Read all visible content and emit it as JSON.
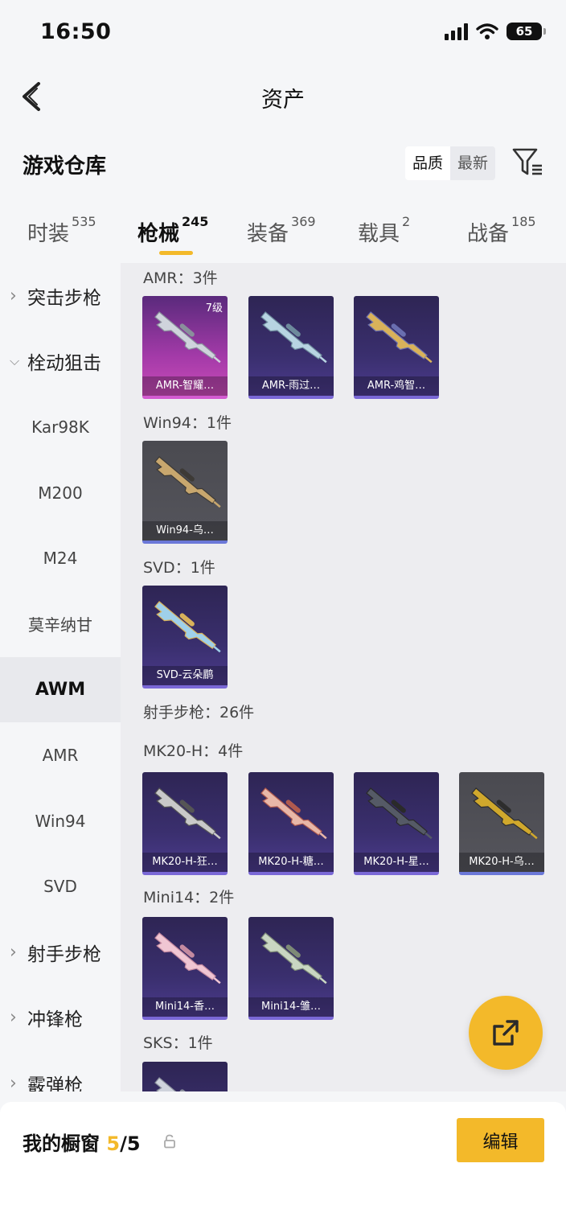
{
  "status_bar": {
    "time": "16:50",
    "battery": "65"
  },
  "header": {
    "title": "资产"
  },
  "warehouse": {
    "title": "游戏仓库",
    "sort_options": [
      "品质",
      "最新"
    ],
    "active_sort": "品质"
  },
  "tabs": [
    {
      "label": "时装",
      "count": "535"
    },
    {
      "label": "枪械",
      "count": "245",
      "active": true
    },
    {
      "label": "装备",
      "count": "369"
    },
    {
      "label": "载具",
      "count": "2"
    },
    {
      "label": "战备",
      "count": "185"
    }
  ],
  "sidebar": {
    "items": [
      {
        "label": "突击步枪",
        "type": "category",
        "expanded": false
      },
      {
        "label": "栓动狙击",
        "type": "category",
        "expanded": true
      },
      {
        "label": "Kar98K",
        "type": "sub"
      },
      {
        "label": "M200",
        "type": "sub"
      },
      {
        "label": "M24",
        "type": "sub"
      },
      {
        "label": "莫辛纳甘",
        "type": "sub"
      },
      {
        "label": "AWM",
        "type": "sub",
        "selected": true
      },
      {
        "label": "AMR",
        "type": "sub"
      },
      {
        "label": "Win94",
        "type": "sub"
      },
      {
        "label": "SVD",
        "type": "sub"
      },
      {
        "label": "射手步枪",
        "type": "category",
        "expanded": false
      },
      {
        "label": "冲锋枪",
        "type": "category",
        "expanded": false
      },
      {
        "label": "霰弹枪",
        "type": "category",
        "expanded": false
      }
    ]
  },
  "groups": [
    {
      "label": "AMR：3件",
      "items": [
        {
          "name": "AMR-智耀…",
          "level": "7级",
          "rarity": "magenta"
        },
        {
          "name": "AMR-雨过…",
          "rarity": "purple"
        },
        {
          "name": "AMR-鸡智…",
          "rarity": "purple"
        }
      ]
    },
    {
      "label": "Win94：1件",
      "items": [
        {
          "name": "Win94-乌…",
          "rarity": "gray"
        }
      ]
    },
    {
      "label": "SVD：1件",
      "items": [
        {
          "name": "SVD-云朵鹛",
          "rarity": "purple"
        }
      ]
    },
    {
      "label": "射手步枪：26件",
      "items": []
    },
    {
      "label": "MK20-H：4件",
      "items": [
        {
          "name": "MK20-H-狂…",
          "rarity": "purple"
        },
        {
          "name": "MK20-H-糖…",
          "rarity": "purple"
        },
        {
          "name": "MK20-H-星…",
          "rarity": "purple"
        },
        {
          "name": "MK20-H-乌…",
          "rarity": "gray"
        }
      ]
    },
    {
      "label": "Mini14：2件",
      "items": [
        {
          "name": "Mini14-香…",
          "rarity": "purple"
        },
        {
          "name": "Mini14-雏…",
          "rarity": "purple"
        }
      ]
    },
    {
      "label": "SKS：1件",
      "items": [
        {
          "name": "",
          "rarity": "purple"
        }
      ]
    }
  ],
  "bottom": {
    "showcase_label": "我的橱窗",
    "count": "5",
    "total": "/5",
    "edit_label": "编辑"
  },
  "colors": {
    "accent": "#f3b92a",
    "purple_card": "#3a2f6e",
    "magenta_card": "#c94bb8",
    "gray_card": "#55555c"
  }
}
